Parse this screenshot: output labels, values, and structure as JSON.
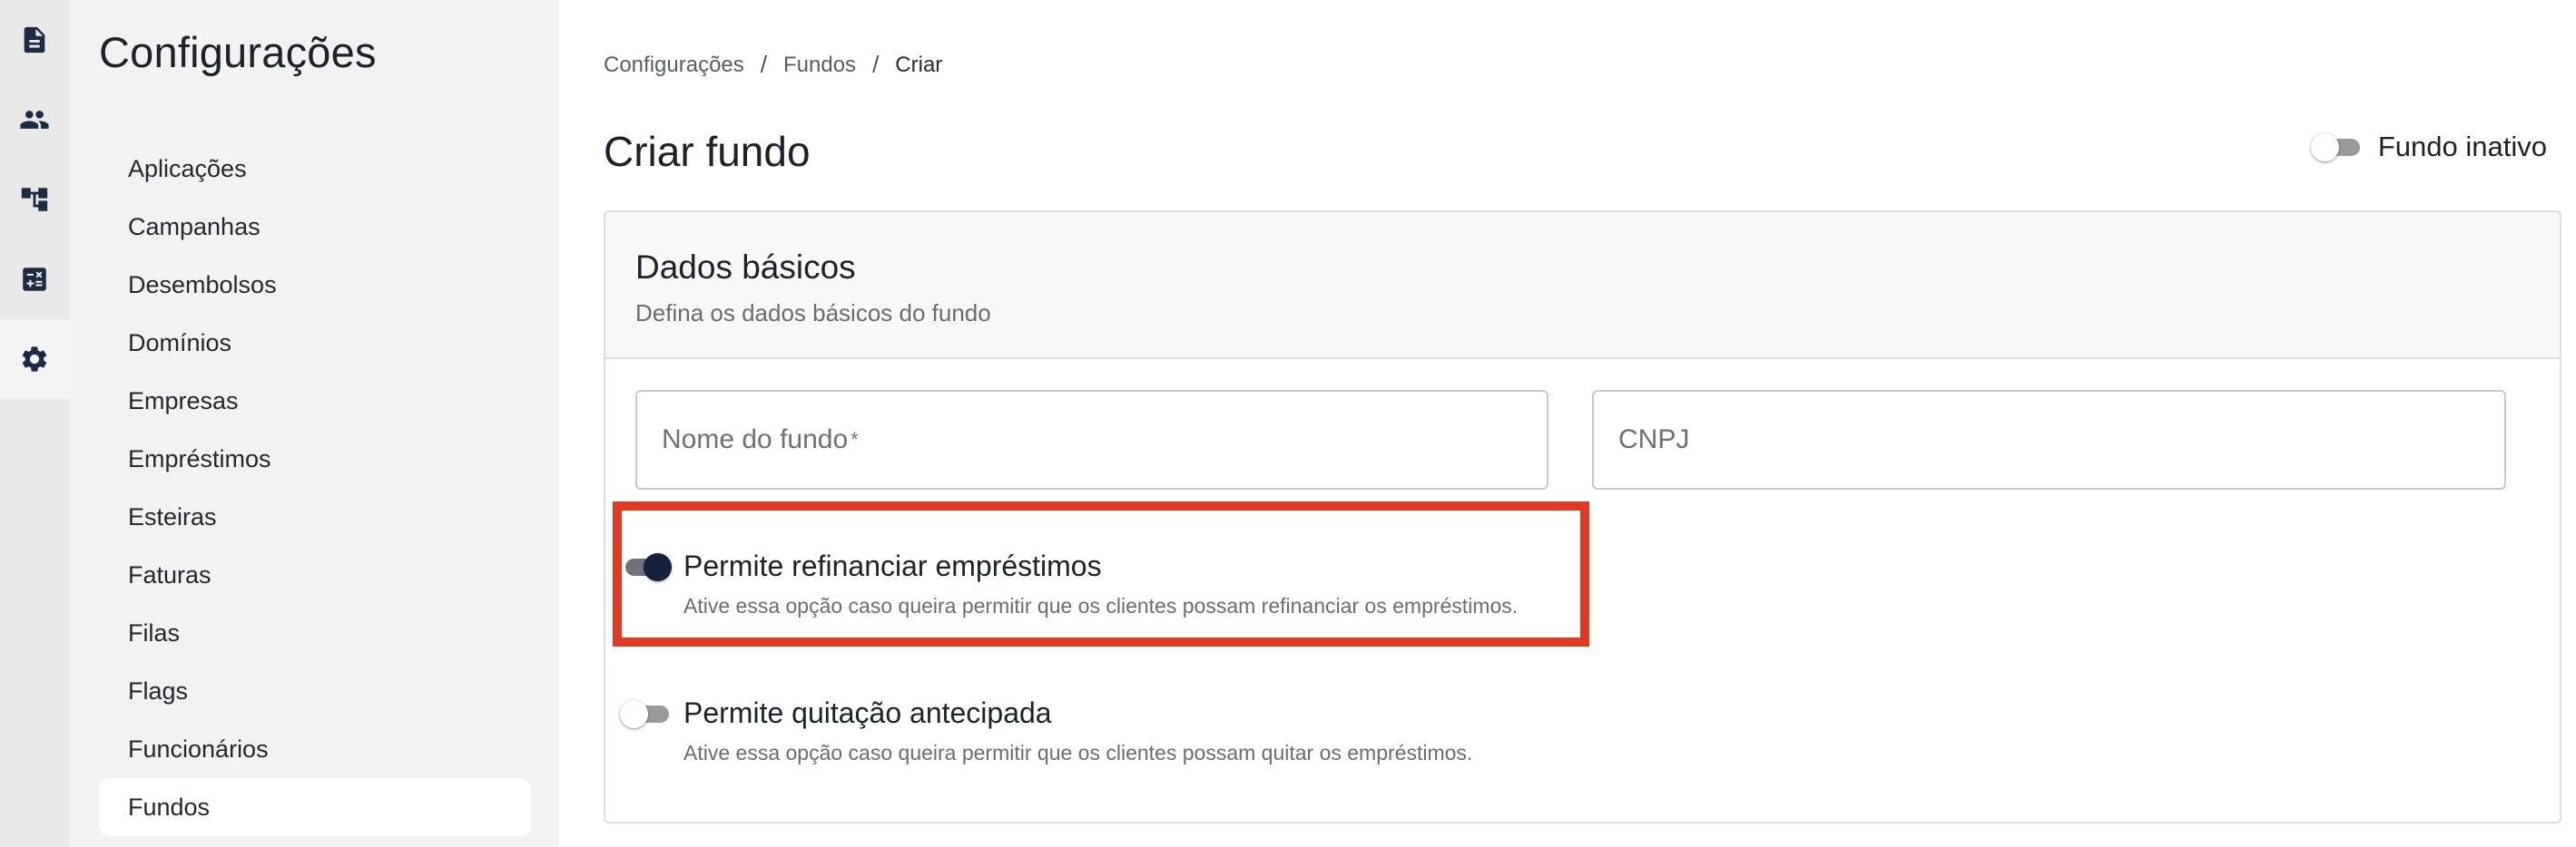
{
  "rail": {
    "icons": [
      "document-icon",
      "people-icon",
      "hierarchy-icon",
      "calculator-icon",
      "gear-icon"
    ],
    "active": "gear-icon"
  },
  "sidebar": {
    "title": "Configurações",
    "items": [
      {
        "label": "Aplicações"
      },
      {
        "label": "Campanhas"
      },
      {
        "label": "Desembolsos"
      },
      {
        "label": "Domínios"
      },
      {
        "label": "Empresas"
      },
      {
        "label": "Empréstimos"
      },
      {
        "label": "Esteiras"
      },
      {
        "label": "Faturas"
      },
      {
        "label": "Filas"
      },
      {
        "label": "Flags"
      },
      {
        "label": "Funcionários"
      },
      {
        "label": "Fundos",
        "active": true
      }
    ]
  },
  "breadcrumb": [
    "Configurações",
    "Fundos",
    "Criar"
  ],
  "page": {
    "title": "Criar fundo",
    "inactive_toggle": {
      "label": "Fundo inativo",
      "checked": false
    }
  },
  "card": {
    "title": "Dados básicos",
    "subtitle": "Defina os dados básicos do fundo",
    "fields": {
      "name": {
        "placeholder": "Nome do fundo",
        "required_mark": "*",
        "value": ""
      },
      "cnpj": {
        "placeholder": "CNPJ",
        "value": ""
      }
    },
    "options": [
      {
        "label": "Permite refinanciar empréstimos",
        "help": "Ative essa opção caso queira permitir que os clientes possam refinanciar os empréstimos.",
        "checked": true
      },
      {
        "label": "Permite quitação antecipada",
        "help": "Ative essa opção caso queira permitir que os clientes possam quitar os empréstimos.",
        "checked": false
      }
    ]
  },
  "colors": {
    "rail_bg": "#e9e9e9",
    "sidebar_bg": "#f2f2f2",
    "icon_color": "#1d2a44",
    "switch_on_thumb": "#16213a",
    "highlight_border": "#e23a22"
  }
}
